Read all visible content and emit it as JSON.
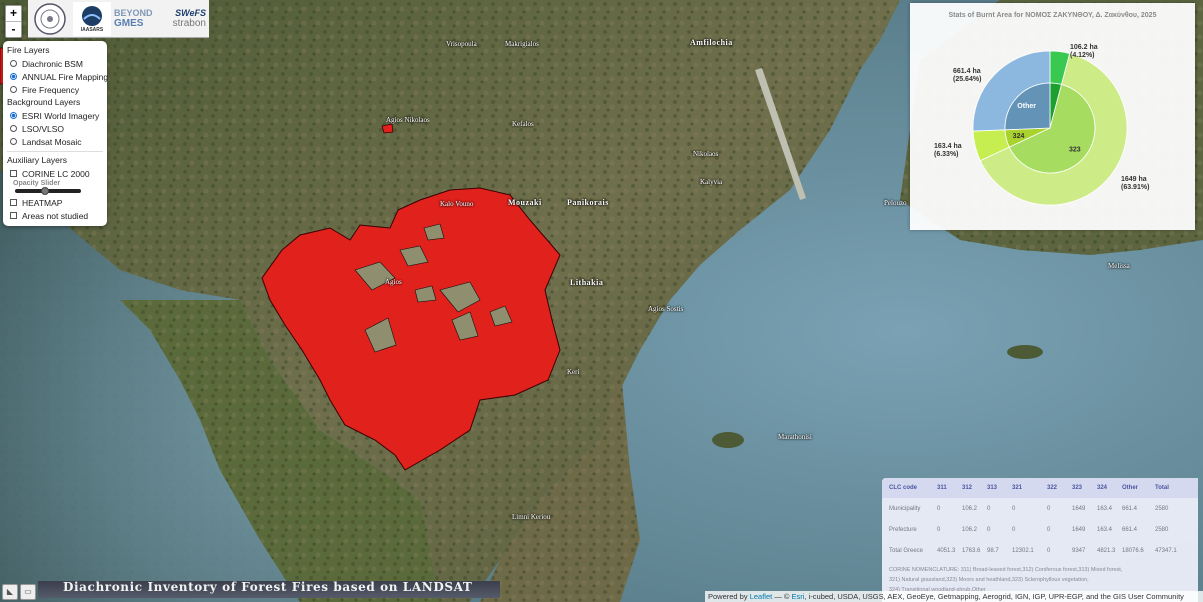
{
  "zoom": {
    "in_label": "+",
    "out_label": "-"
  },
  "logos": {
    "iaa": "IAASARS",
    "beyond": "BEYOND",
    "swefs": "SWeFS",
    "gmes": "GMES",
    "strabon": "strabon"
  },
  "layers": {
    "fire_header": "Fire Layers",
    "fire_items": [
      {
        "label": "Diachronic BSM",
        "checked": false
      },
      {
        "label": "ANNUAL Fire Mapping",
        "checked": true
      },
      {
        "label": "Fire Frequency",
        "checked": false
      }
    ],
    "background_header": "Background Layers",
    "background_items": [
      {
        "label": "ESRI World Imagery",
        "checked": true
      },
      {
        "label": "LSO/VLSO",
        "checked": false
      },
      {
        "label": "Landsat Mosaic",
        "checked": false
      }
    ],
    "auxiliary_header": "Auxiliary Layers",
    "corine_label": "CORINE LC 2000",
    "opacity_label": "Opacity Slider",
    "opacity_value": 0.45,
    "heatmap_label": "HEATMAP",
    "areas_label": "Areas not studied"
  },
  "places": {
    "p1": "Vrisopoula",
    "p2": "Makrigialos",
    "p3": "Amfilochia",
    "p4": "Agios Nikolaos",
    "p5": "Kefalos",
    "p6": "Nikolaos",
    "p7": "Kalyvia",
    "p8": "Kalo Vouno",
    "p9": "Mouzaki",
    "p10": "Panikorais",
    "p11": "Agios",
    "p12": "Lithakia",
    "p13": "Agios Sostis",
    "p14": "Keri",
    "p15": "Marathonisi",
    "p16": "Limni Keriou",
    "p17": "Pelouzo",
    "p18": "Melissa"
  },
  "stats": {
    "title": "Stats of Burnt Area for ΝΟΜΟΣ ΖΑΚΥΝΘΟΥ, Δ. Ζακύνθου, 2025",
    "slices": [
      {
        "code": "323",
        "ha": "1649 ha",
        "pct": "(63.91%)",
        "value": 1649,
        "color": "#cdec87",
        "inner": "#a6dc5f"
      },
      {
        "code": "324",
        "ha": "163.4 ha",
        "pct": "(6.33%)",
        "value": 163.4,
        "color": "#c6ee50",
        "inner": "#a9d22c"
      },
      {
        "code": "Other",
        "ha": "661.4 ha",
        "pct": "(25.64%)",
        "value": 661.4,
        "color": "#8cb8df",
        "inner": "#6394b8"
      },
      {
        "code": "321",
        "ha": "106.2 ha",
        "pct": "(4.12%)",
        "value": 106.2,
        "color": "#39c850",
        "inner": "#1ca030"
      }
    ]
  },
  "table": {
    "headers": [
      "CLC code",
      "311",
      "312",
      "313",
      "321",
      "",
      "322",
      "323",
      "324",
      "Other",
      "Total"
    ],
    "rows": [
      [
        "Municipality",
        "0",
        "106.2",
        "0",
        "0",
        "",
        "0",
        "1649",
        "163.4",
        "661.4",
        "2580"
      ],
      [
        "Prefecture",
        "0",
        "106.2",
        "0",
        "0",
        "",
        "0",
        "1649",
        "163.4",
        "661.4",
        "2580"
      ],
      [
        "Total Greece",
        "4051.3",
        "1763.6",
        "98.7",
        "12302.1",
        "",
        "0",
        "9347",
        "4821.3",
        "18076.6",
        "47347.1"
      ]
    ],
    "note1": "CORINE NOMENCLATURE: 311) Broad-leaved forest,312) Coniferous forest,313) Mixed forest,",
    "note2": "321) Natural grassland,323) Moors and heathland,323) Sclerophyllous vegetation,",
    "note3": "324) Transitional woodland-shrub,Other"
  },
  "bottom": {
    "btn1": "◣",
    "btn2": "▭",
    "banner": "Diachronic Inventory of Forest Fires based on LANDSAT"
  },
  "attribution": {
    "prefix": "Powered by",
    "leaflet": "Leaflet",
    "dash": " — © ",
    "esri": "Esri",
    "rest": ", i-cubed, USDA, USGS, AEX, GeoEye, Getmapping, Aerogrid, IGN, IGP, UPR-EGP, and the GIS User Community"
  }
}
